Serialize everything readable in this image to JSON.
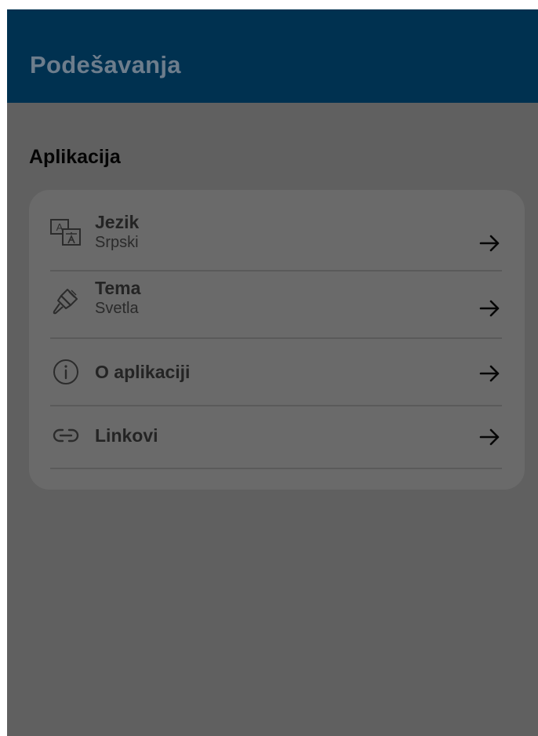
{
  "header": {
    "title": "Podešavanja"
  },
  "section": {
    "title": "Aplikacija"
  },
  "settings": {
    "items": [
      {
        "title": "Jezik",
        "subtitle": "Srpski",
        "icon": "translate-icon"
      },
      {
        "title": "Tema",
        "subtitle": "Svetla",
        "icon": "paintbrush-icon"
      },
      {
        "title": "O aplikaciji",
        "icon": "info-icon"
      },
      {
        "title": "Linkovi",
        "icon": "link-icon"
      }
    ]
  },
  "colors": {
    "app_bar": "#003150",
    "background": "#606060",
    "card": "#6a6a6a"
  }
}
